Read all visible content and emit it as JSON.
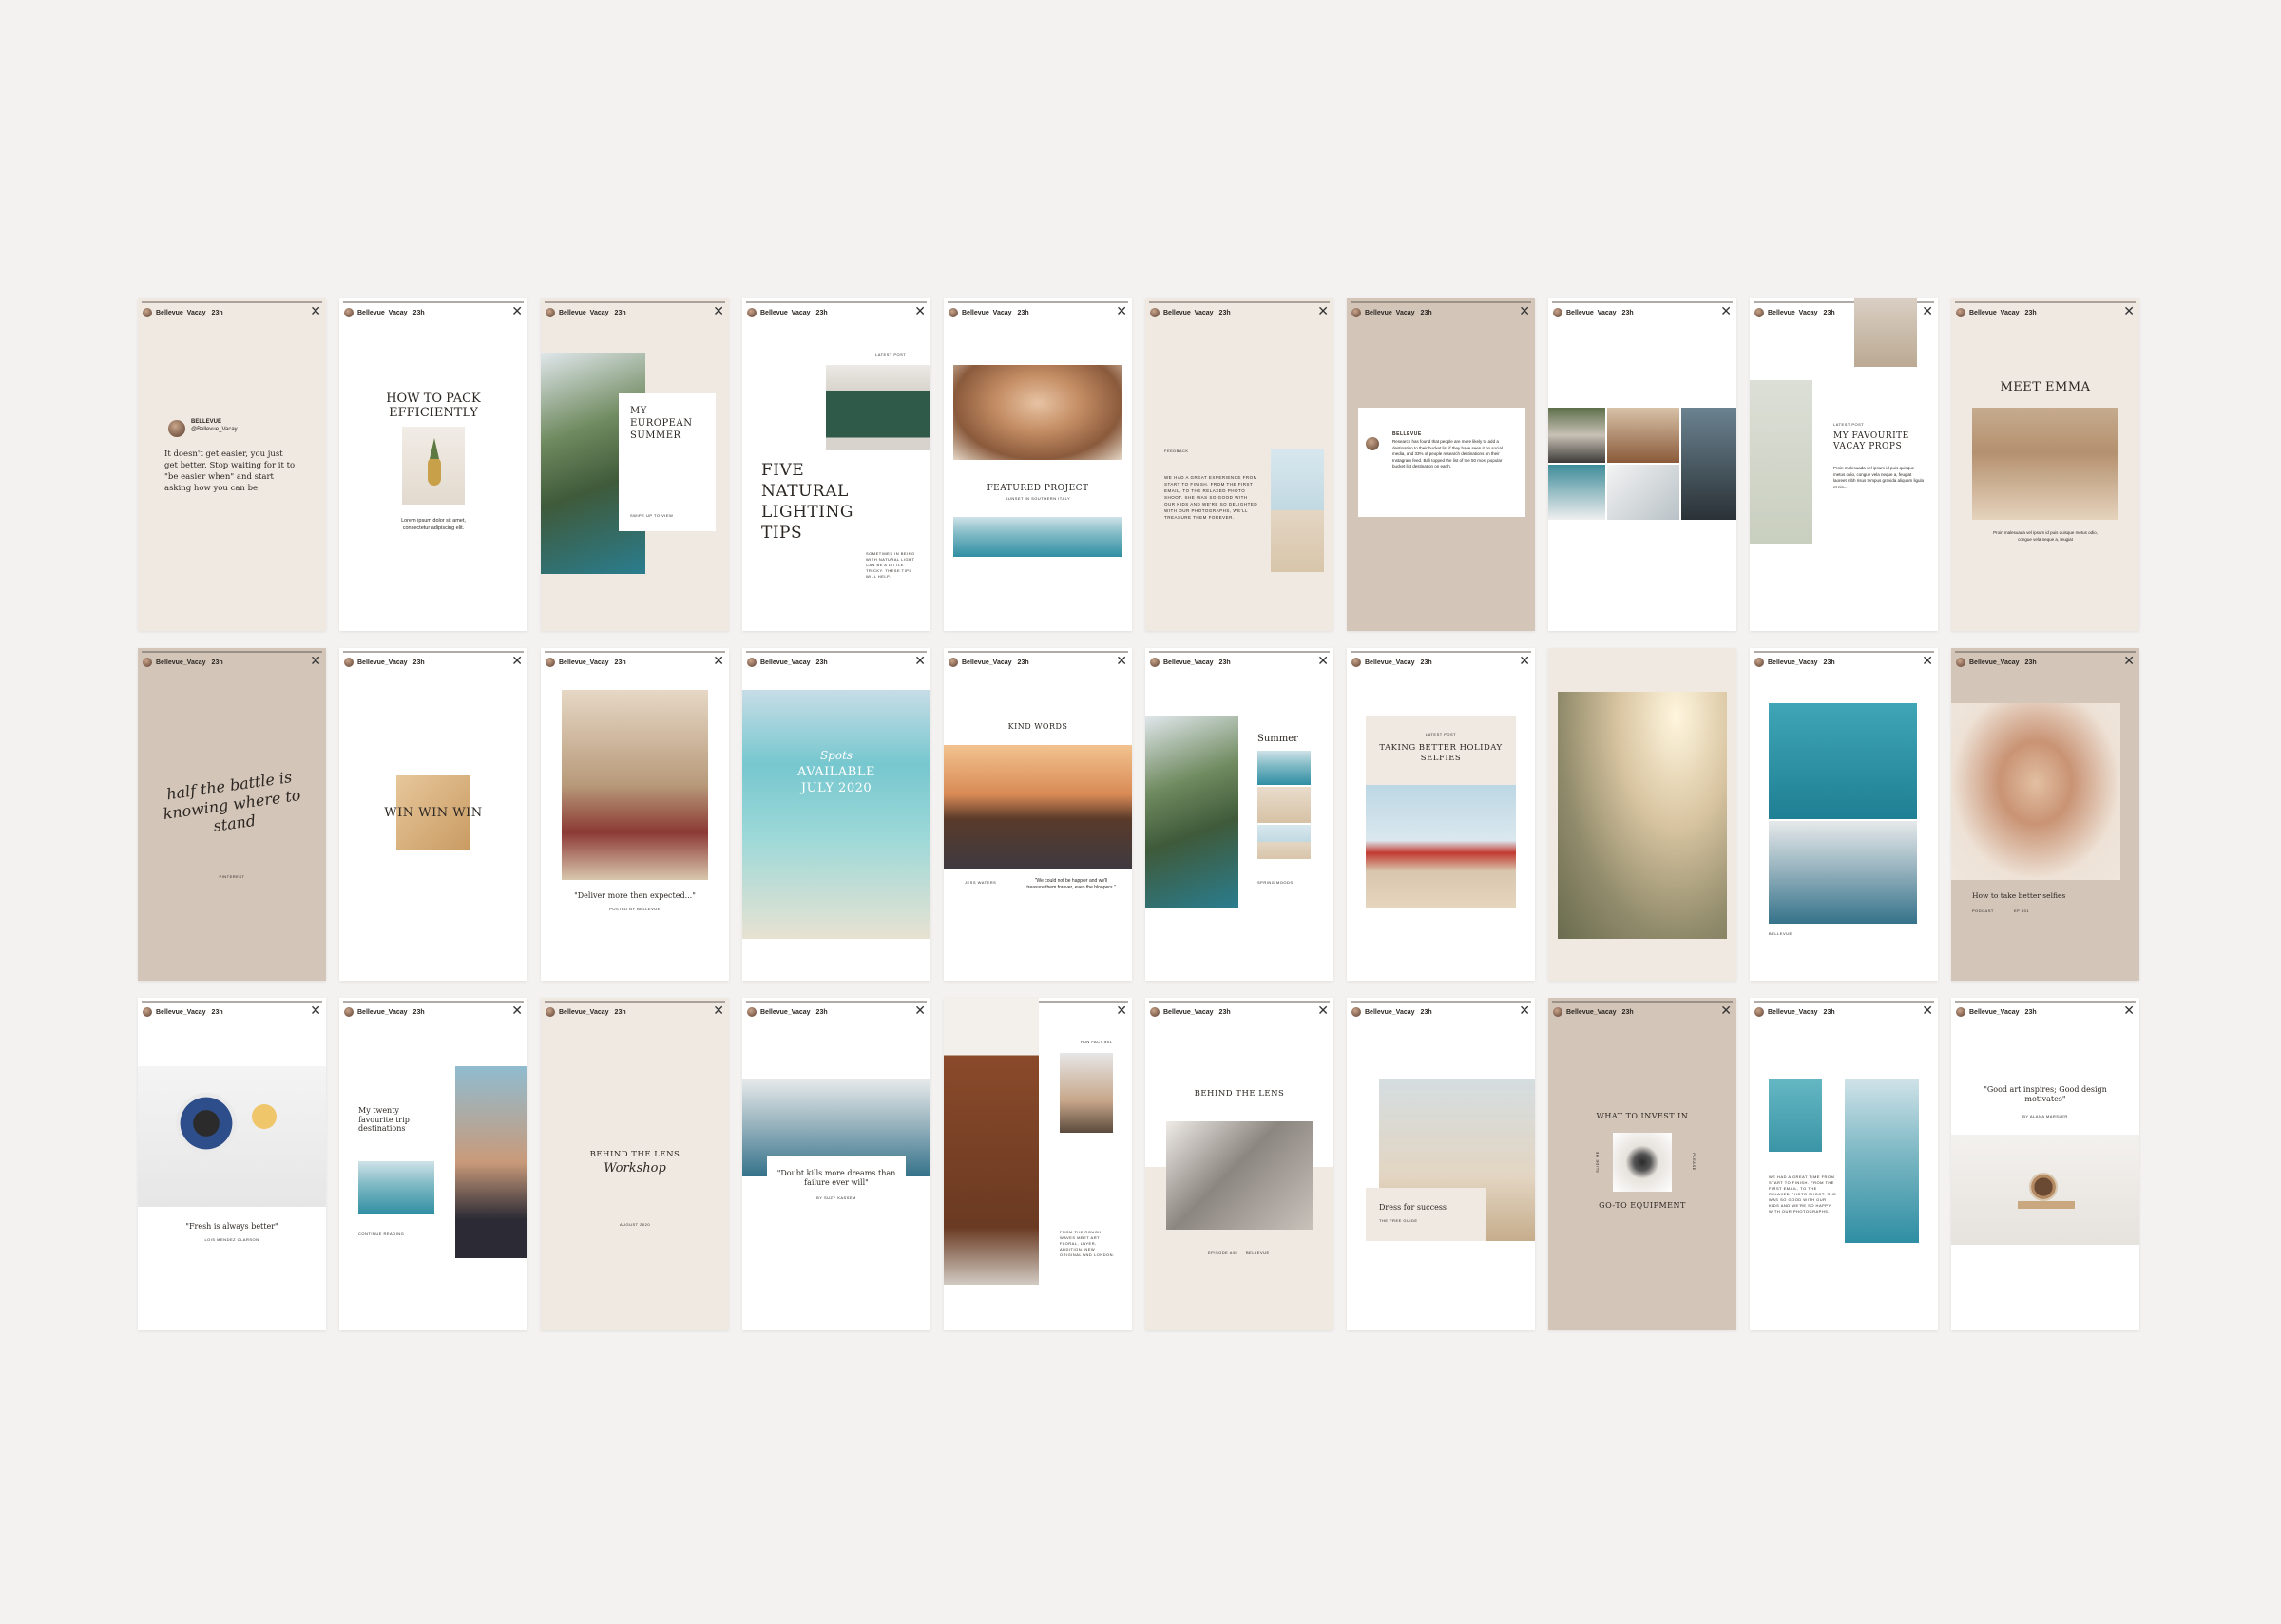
{
  "story": {
    "handle": "Bellevue_Vacay",
    "time": "23h",
    "close": "✕"
  },
  "cards": {
    "r1c1": {
      "brand": "BELLEVUE",
      "at": "@Bellevue_Vacay",
      "quote": "It doesn't get easier, you just get better. Stop waiting for it to \"be easier when\" and start asking how you can be."
    },
    "r1c2": {
      "title": "HOW TO PACK EFFICIENTLY",
      "body": "Lorem ipsum dolor sit amet, consectetur adipiscing elit."
    },
    "r1c3": {
      "title": "MY EUROPEAN SUMMER",
      "small": "SWIPE UP TO VIEW"
    },
    "r1c4": {
      "kicker": "LATEST POST",
      "title": "FIVE NATURAL LIGHTING TIPS",
      "body": "SOMETIMES IN BEING WITH NATURAL LIGHT CAN BE A LITTLE TRICKY. THESE TIPS WILL HELP."
    },
    "r1c5": {
      "title": "FEATURED PROJECT",
      "sub": "SUNSET IN SOUTHERN ITALY"
    },
    "r1c6": {
      "kicker": "FEEDBACK",
      "body": "WE HAD A GREAT EXPERIENCE FROM START TO FINISH. FROM THE FIRST EMAIL, TO THE RELAXED PHOTO SHOOT. SHE WAS SO GOOD WITH OUR KIDS AND WE'RE SO DELIGHTED WITH OUR PHOTOGRAPHS, WE'LL TREASURE THEM FOREVER."
    },
    "r1c7": {
      "brand": "BELLEVUE",
      "body": "Research has found that people are more likely to add a destination to their bucket list if they have seen it on social media, and 33% of people research destinations on their Instagram feed. Bali topped the list of the 50 most popular bucket list destination on earth."
    },
    "r1c9": {
      "kicker": "LATEST POST",
      "title": "MY FAVOURITE VACAY PROPS",
      "body": "Proin malesuada vel ipsum id puis quisque metus odio, congue vela neque a, feugiat laoreet nibh risus tempus gravida aliquam ligula et nis..."
    },
    "r1c10": {
      "title": "MEET EMMA",
      "body": "Proin malesuada vel ipsum id puis quisque metus odio, congue vela neque a, feugiat"
    },
    "r2c1": {
      "script": "half the battle is knowing where to stand",
      "small": "PINTEREST"
    },
    "r2c2": {
      "title": "WIN WIN WIN"
    },
    "r2c3": {
      "quote": "\"Deliver more then expected...\"",
      "small": "POSTED BY BELLEVUE"
    },
    "r2c4": {
      "script": "Spots",
      "title": "AVAILABLE JULY 2020"
    },
    "r2c5": {
      "title": "KIND WORDS",
      "name": "JESS WATERS",
      "quote": "\"We could not be happier and we'll treasure them forever, even the bloopers.\""
    },
    "r2c6": {
      "title": "Summer",
      "small": "SPRING MOODS"
    },
    "r2c7": {
      "kicker": "LATEST POST",
      "title": "TAKING BETTER HOLIDAY SELFIES"
    },
    "r2c9": {
      "small": "BELLEVUE"
    },
    "r2c10": {
      "title": "How to take better selfies",
      "left": "PODCAST",
      "right": "EP 401"
    },
    "r3c1": {
      "quote": "\"Fresh is always better\"",
      "small": "LOIS MENDEZ CLARSON"
    },
    "r3c2": {
      "title": "My twenty favourite trip destinations",
      "small": "CONTINUE READING"
    },
    "r3c3": {
      "title": "BEHIND THE LENS",
      "script": "Workshop",
      "small": "AUGUST 2020"
    },
    "r3c4": {
      "quote": "\"Doubt kills more dreams than failure ever will\"",
      "small": "BY SUZY KASSEM"
    },
    "r3c5": {
      "small": "FUN FACT #01",
      "body": "FROM THE ROUGH WAVES MEET ART FLORAL, LAYER, ADDITION, NEW ORIGINAL AND LONDON."
    },
    "r3c6": {
      "title": "BEHIND THE LENS",
      "left": "EPISODE #45",
      "right": "BELLEVUE"
    },
    "r3c7": {
      "title": "Dress for success",
      "small": "THE FREE GUIDE"
    },
    "r3c8": {
      "top": "WHAT TO INVEST IN",
      "bottom": "GO-TO EQUIPMENT",
      "left": "SLIDE ME",
      "right": "PLEASE"
    },
    "r3c9": {
      "body": "WE HAD A GREAT TIME FROM START TO FINISH. FROM THE FIRST EMAIL, TO THE RELAXED PHOTO SHOOT. SHE WAS SO GOOD WITH OUR KIDS AND WE'RE SO HAPPY WITH OUR PHOTOGRAPHS."
    },
    "r3c10": {
      "quote": "\"Good art inspires; Good design motivates\"",
      "small": "BY ALANA MARSLER"
    }
  },
  "colors": {
    "background": "#f4f2f0",
    "white": "#ffffff",
    "cream": "#efe9e2",
    "taupe": "#d3c5b8",
    "ink": "#2b2622"
  }
}
